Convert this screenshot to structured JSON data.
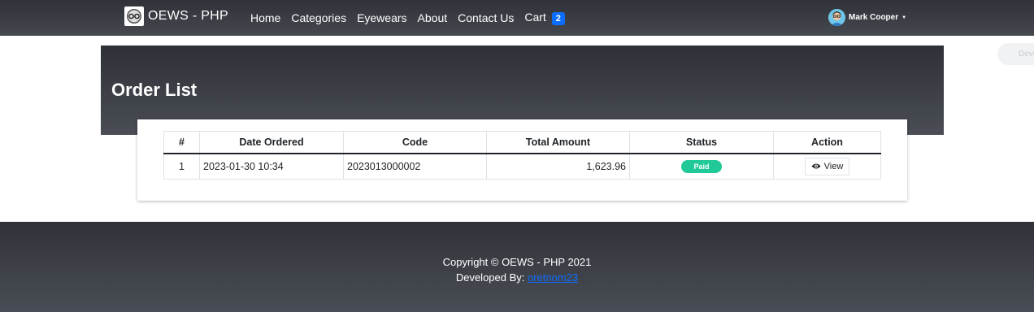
{
  "navbar": {
    "brand_name": "OEWS - PHP",
    "links": [
      {
        "label": "Home"
      },
      {
        "label": "Categories"
      },
      {
        "label": "Eyewears"
      },
      {
        "label": "About"
      },
      {
        "label": "Contact Us"
      }
    ],
    "cart": {
      "label": "Cart",
      "count": "2"
    },
    "user": {
      "name": "Mark Cooper"
    }
  },
  "side_pill": {
    "label": "Deve"
  },
  "page": {
    "title": "Order List"
  },
  "table": {
    "headers": [
      "#",
      "Date Ordered",
      "Code",
      "Total Amount",
      "Status",
      "Action"
    ],
    "rows": [
      {
        "num": "1",
        "date": "2023-01-30 10:34",
        "code": "2023013000002",
        "total": "1,623.96",
        "status": "Paid",
        "action": "View"
      }
    ]
  },
  "footer": {
    "copyright": "Copyright © OEWS - PHP 2021",
    "developed_by_label": "Developed By: ",
    "developer": "oretnom23"
  },
  "colors": {
    "nav_bg": "#3a3d43",
    "cart_badge": "#0d6efd",
    "paid_badge": "#20c997",
    "link": "#0d6efd"
  }
}
